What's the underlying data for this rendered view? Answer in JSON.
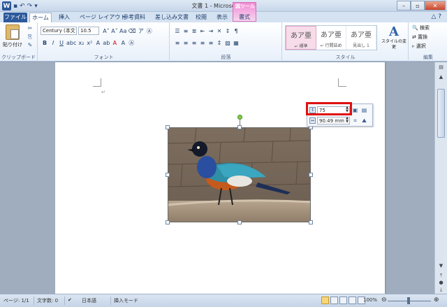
{
  "title_bar": {
    "app_icon": "W",
    "title": "文書 1 - Microsoft Word",
    "qat_items": [
      "save-icon",
      "undo-icon",
      "redo-icon",
      "customize-icon"
    ],
    "window_controls": [
      "minimize",
      "maximize",
      "close"
    ]
  },
  "tabs": {
    "file": "ファイル",
    "home": "ホーム",
    "insert": "挿入",
    "page_layout": "ページ レイアウト",
    "references": "参考資料",
    "mailings": "差し込み文書",
    "review": "校閲",
    "view": "表示",
    "context_group": "図ツール",
    "format": "書式"
  },
  "ribbon": {
    "clipboard": {
      "label": "クリップボード",
      "paste": "貼り付け"
    },
    "font": {
      "label": "フォント",
      "font_name": "Century (本文",
      "font_size": "10.5"
    },
    "paragraph": {
      "label": "段落"
    },
    "styles": {
      "label": "スタイル",
      "items": [
        {
          "preview": "あア亜",
          "name": "↵ 標準"
        },
        {
          "preview": "あア亜",
          "name": "↵ 行間詰め"
        },
        {
          "preview": "あア亜",
          "name": "見出し 1"
        }
      ],
      "change_styles": "スタイルの変更"
    },
    "editing": {
      "label": "編集",
      "find": "検索",
      "replace": "置換",
      "select": "選択"
    }
  },
  "document": {
    "paragraph_mark": "↵"
  },
  "mini_toolbar": {
    "height_value": "75",
    "width_value": "90.49 mm"
  },
  "status_bar": {
    "page": "ページ: 1/1",
    "word_count": "文字数: 0",
    "language": "日本語",
    "mode": "挿入モード",
    "zoom": "100%"
  },
  "colors": {
    "file_tab": "#2c5a9c",
    "highlight": "#e01010",
    "context_tab": "#f28ad4"
  }
}
